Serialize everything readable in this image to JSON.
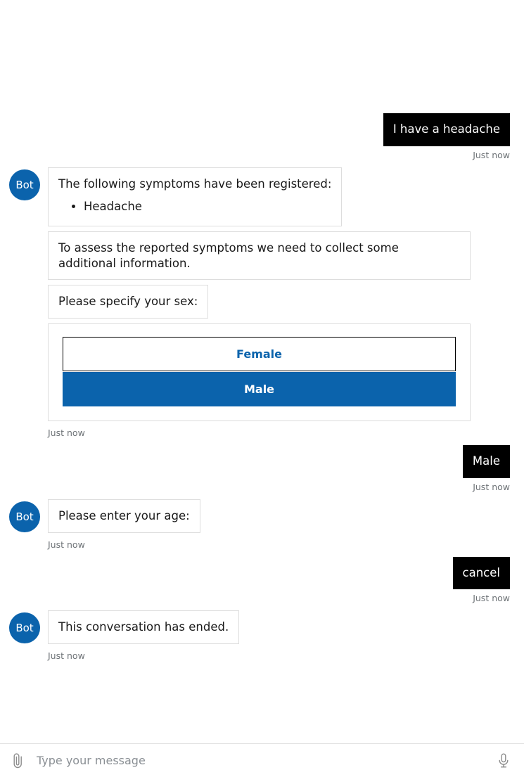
{
  "bot": {
    "avatar_label": "Bot",
    "avatar_color": "#0b63ac"
  },
  "colors": {
    "user_bubble_bg": "#000000",
    "user_bubble_text": "#ffffff",
    "bot_bubble_bg": "#ffffff",
    "bot_bubble_border": "#dddddd",
    "accent": "#0b63ac",
    "timestamp_text": "#6e7377"
  },
  "messages": {
    "user_headache": {
      "text": "I have a headache",
      "time": "Just now"
    },
    "bot_symptoms": {
      "intro": "The following symptoms have been registered:",
      "symptoms": [
        "Headache"
      ],
      "assess": "To assess the reported symptoms we need to collect some additional information.",
      "ask_sex": "Please specify your sex:",
      "options": [
        {
          "label": "Female",
          "selected": false
        },
        {
          "label": "Male",
          "selected": true
        }
      ],
      "time": "Just now"
    },
    "user_male": {
      "text": "Male",
      "time": "Just now"
    },
    "bot_age": {
      "text": "Please enter your age:",
      "time": "Just now"
    },
    "user_cancel": {
      "text": "cancel",
      "time": "Just now"
    },
    "bot_ended": {
      "text": "This conversation has ended.",
      "time": "Just now"
    }
  },
  "composer": {
    "placeholder": "Type your message",
    "value": "",
    "attach_icon": "paperclip-icon",
    "mic_icon": "microphone-icon"
  }
}
